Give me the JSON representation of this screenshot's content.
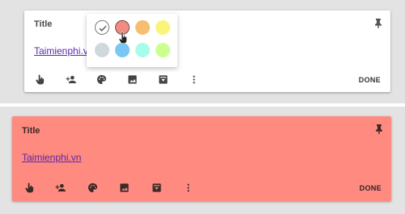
{
  "cards": [
    {
      "title": "Title",
      "link_text": "Taimienphi.vn",
      "done_label": "DONE",
      "background": "#ffffff"
    },
    {
      "title": "Title",
      "link_text": "Taimienphi.vn",
      "done_label": "DONE",
      "background": "#ff8a80"
    }
  ],
  "toolbar_icons": [
    "reminder-hand-icon",
    "add-collaborator-icon",
    "palette-icon",
    "image-icon",
    "archive-icon",
    "more-vert-icon"
  ],
  "palette": {
    "colors": [
      {
        "name": "white",
        "hex": "#ffffff",
        "selected": true
      },
      {
        "name": "red",
        "hex": "#f28b82",
        "selected": false
      },
      {
        "name": "orange",
        "hex": "#f6bf70",
        "selected": false
      },
      {
        "name": "yellow",
        "hex": "#fbf47a",
        "selected": false
      },
      {
        "name": "gray",
        "hex": "#cfd8dc",
        "selected": false
      },
      {
        "name": "blue",
        "hex": "#79c7f2",
        "selected": false
      },
      {
        "name": "teal",
        "hex": "#a7fdeb",
        "selected": false
      },
      {
        "name": "green",
        "hex": "#ccff90",
        "selected": false
      }
    ]
  }
}
